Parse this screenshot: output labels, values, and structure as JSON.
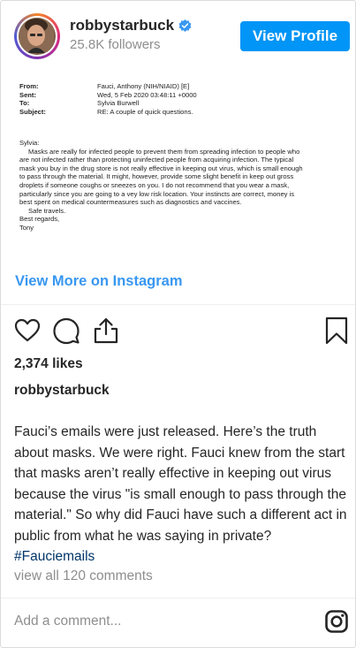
{
  "header": {
    "username": "robbystarbuck",
    "followers": "25.8K followers",
    "view_profile_label": "View Profile",
    "accent_color": "#0095f6",
    "verified_icon": "verified-badge-icon"
  },
  "email": {
    "fields": [
      {
        "label": "From:",
        "value": "Fauci, Anthony (NIH/NIAID) [E]"
      },
      {
        "label": "Sent:",
        "value": "Wed, 5 Feb 2020 03:48:11 +0000"
      },
      {
        "label": "To:",
        "value": "Sylvia Burwell"
      },
      {
        "label": "Subject:",
        "value": "RE: A couple of quick questions."
      }
    ],
    "greeting": "Sylvia:",
    "lines": [
      "Masks are really for infected people to prevent them from spreading infection to people who",
      "are not infected rather than protecting uninfected people from acquiring infection.  The typical",
      "mask you buy in the drug store is not really effective in keeping out virus, which is small enough",
      "to pass through the material.  It might, however, provide some slight benefit in keep out gross",
      "droplets if someone coughs or sneezes on you.  I do not recommend that you wear a mask,",
      "particularly since you are going to a vey low risk location.  Your instincts are correct, money is",
      "best spent on medical countermeasures such as diagnostics and vaccines."
    ],
    "safe_travels": "Safe travels.",
    "closing": "Best regards,",
    "signature": "Tony"
  },
  "view_more_label": "View More on Instagram",
  "actions": {
    "like_icon": "heart-icon",
    "comment_icon": "comment-icon",
    "share_icon": "share-icon",
    "save_icon": "bookmark-icon"
  },
  "likes": "2,374 likes",
  "caption": {
    "username": "robbystarbuck",
    "text": "Fauci’s emails were just released. Here’s the truth about masks. We were right. Fauci knew from the start that masks aren’t really effective in keeping out virus because the virus \"is small enough to pass through the material.\" So why did Fauci have such a different act in public from what he was saying in private? ",
    "hashtag": "#Fauciemails"
  },
  "view_comments": "view all 120 comments",
  "comment_placeholder": "Add a comment...",
  "footer_icon": "instagram-icon"
}
